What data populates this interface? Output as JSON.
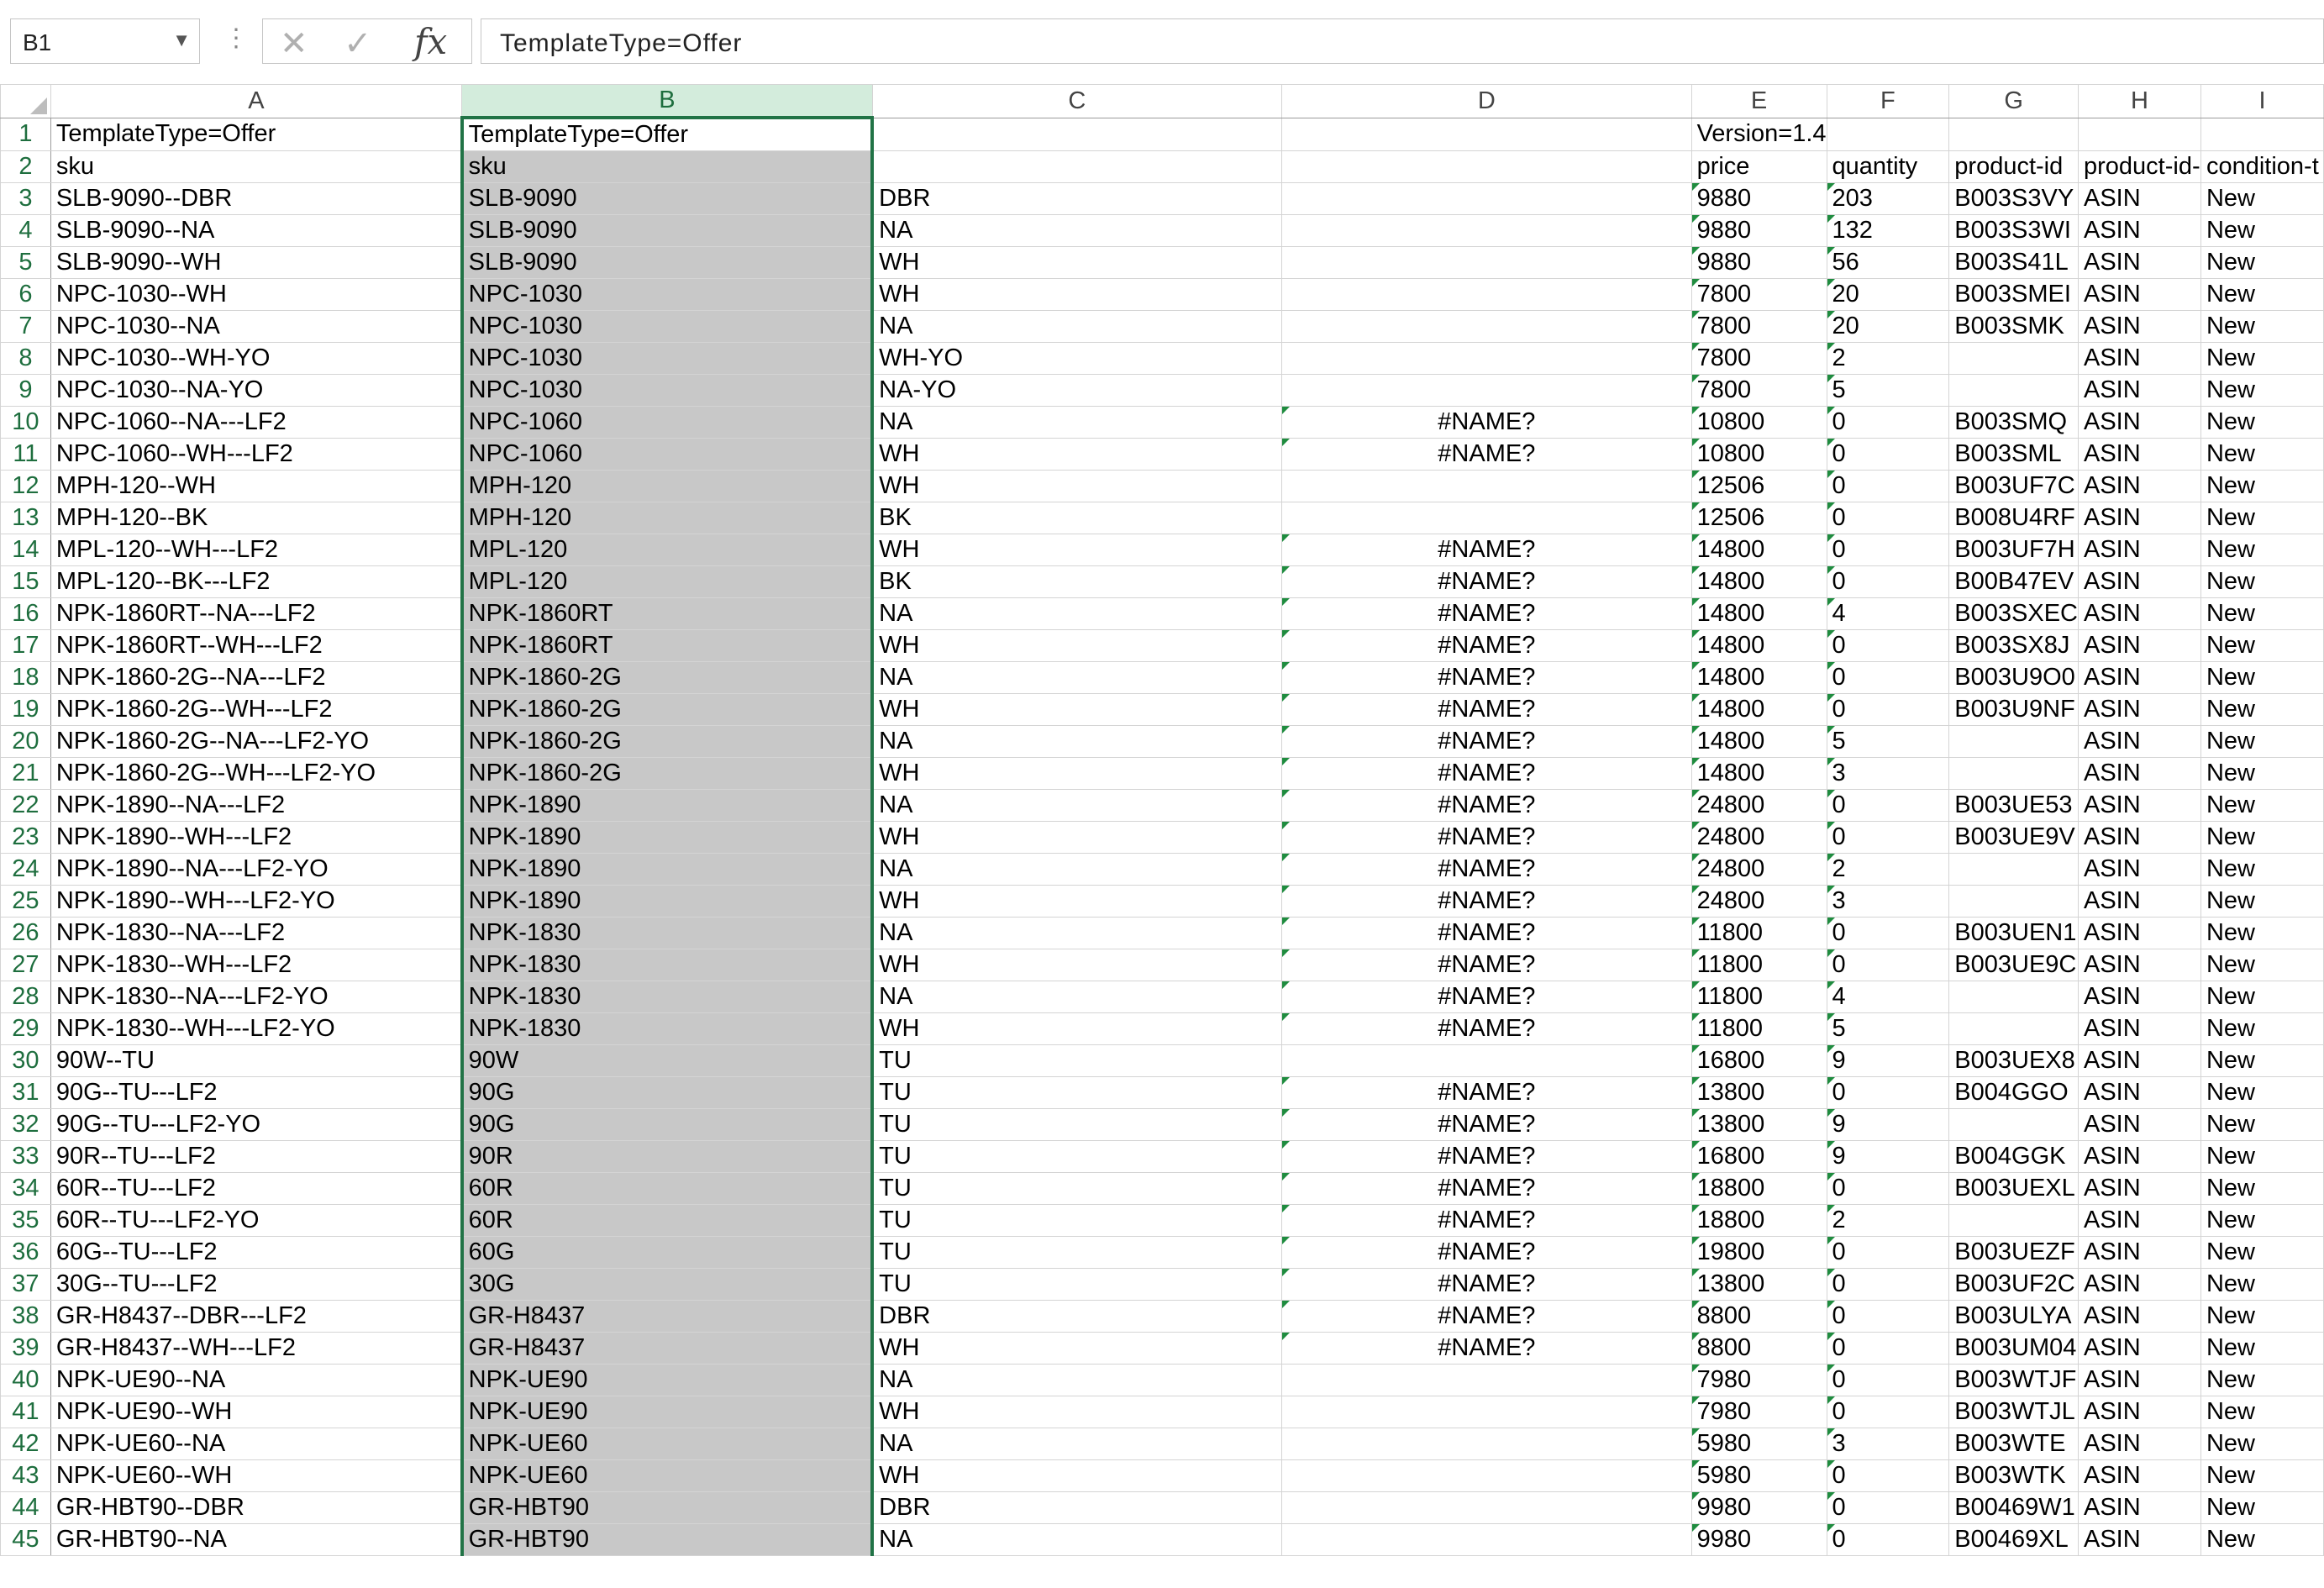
{
  "formula_bar": {
    "name_box": "B1",
    "formula": "TemplateType=Offer"
  },
  "columns": [
    "A",
    "B",
    "C",
    "D",
    "E",
    "F",
    "G",
    "H",
    "I"
  ],
  "rows": [
    {
      "n": "1",
      "a": "TemplateType=Offer",
      "b": "TemplateType=Offer",
      "c": "",
      "d": "",
      "e": "Version=1.4",
      "f": "",
      "g": "",
      "h": "",
      "i": ""
    },
    {
      "n": "2",
      "a": "sku",
      "b": "sku",
      "c": "",
      "d": "",
      "e": "price",
      "f": "quantity",
      "g": "product-id",
      "h": "product-id-",
      "i": "condition-t"
    },
    {
      "n": "3",
      "a": "SLB-9090--DBR",
      "b": "SLB-9090",
      "c": "DBR",
      "d": "",
      "e": "9880",
      "f": "203",
      "g": "B003S3VY",
      "h": "ASIN",
      "i": "New"
    },
    {
      "n": "4",
      "a": "SLB-9090--NA",
      "b": "SLB-9090",
      "c": "NA",
      "d": "",
      "e": "9880",
      "f": "132",
      "g": "B003S3WI",
      "h": "ASIN",
      "i": "New"
    },
    {
      "n": "5",
      "a": "SLB-9090--WH",
      "b": "SLB-9090",
      "c": "WH",
      "d": "",
      "e": "9880",
      "f": "56",
      "g": "B003S41L",
      "h": "ASIN",
      "i": "New"
    },
    {
      "n": "6",
      "a": "NPC-1030--WH",
      "b": "NPC-1030",
      "c": "WH",
      "d": "",
      "e": "7800",
      "f": "20",
      "g": "B003SMEI",
      "h": "ASIN",
      "i": "New"
    },
    {
      "n": "7",
      "a": "NPC-1030--NA",
      "b": "NPC-1030",
      "c": "NA",
      "d": "",
      "e": "7800",
      "f": "20",
      "g": "B003SMK",
      "h": "ASIN",
      "i": "New"
    },
    {
      "n": "8",
      "a": "NPC-1030--WH-YO",
      "b": "NPC-1030",
      "c": "WH-YO",
      "d": "",
      "e": "7800",
      "f": "2",
      "g": "",
      "h": "ASIN",
      "i": "New"
    },
    {
      "n": "9",
      "a": "NPC-1030--NA-YO",
      "b": "NPC-1030",
      "c": "NA-YO",
      "d": "",
      "e": "7800",
      "f": "5",
      "g": "",
      "h": "ASIN",
      "i": "New"
    },
    {
      "n": "10",
      "a": "NPC-1060--NA---LF2",
      "b": "NPC-1060",
      "c": "NA",
      "d": "#NAME?",
      "e": "10800",
      "f": "0",
      "g": "B003SMQ",
      "h": "ASIN",
      "i": "New"
    },
    {
      "n": "11",
      "a": "NPC-1060--WH---LF2",
      "b": "NPC-1060",
      "c": "WH",
      "d": "#NAME?",
      "e": "10800",
      "f": "0",
      "g": "B003SML",
      "h": "ASIN",
      "i": "New"
    },
    {
      "n": "12",
      "a": "MPH-120--WH",
      "b": "MPH-120",
      "c": "WH",
      "d": "",
      "e": "12506",
      "f": "0",
      "g": "B003UF7C",
      "h": "ASIN",
      "i": "New"
    },
    {
      "n": "13",
      "a": "MPH-120--BK",
      "b": "MPH-120",
      "c": "BK",
      "d": "",
      "e": "12506",
      "f": "0",
      "g": "B008U4RF",
      "h": "ASIN",
      "i": "New"
    },
    {
      "n": "14",
      "a": "MPL-120--WH---LF2",
      "b": "MPL-120",
      "c": "WH",
      "d": "#NAME?",
      "e": "14800",
      "f": "0",
      "g": "B003UF7H",
      "h": "ASIN",
      "i": "New"
    },
    {
      "n": "15",
      "a": "MPL-120--BK---LF2",
      "b": "MPL-120",
      "c": "BK",
      "d": "#NAME?",
      "e": "14800",
      "f": "0",
      "g": "B00B47EV",
      "h": "ASIN",
      "i": "New"
    },
    {
      "n": "16",
      "a": "NPK-1860RT--NA---LF2",
      "b": "NPK-1860RT",
      "c": "NA",
      "d": "#NAME?",
      "e": "14800",
      "f": "4",
      "g": "B003SXEC",
      "h": "ASIN",
      "i": "New"
    },
    {
      "n": "17",
      "a": "NPK-1860RT--WH---LF2",
      "b": "NPK-1860RT",
      "c": "WH",
      "d": "#NAME?",
      "e": "14800",
      "f": "0",
      "g": "B003SX8J",
      "h": "ASIN",
      "i": "New"
    },
    {
      "n": "18",
      "a": "NPK-1860-2G--NA---LF2",
      "b": "NPK-1860-2G",
      "c": "NA",
      "d": "#NAME?",
      "e": "14800",
      "f": "0",
      "g": "B003U9O0",
      "h": "ASIN",
      "i": "New"
    },
    {
      "n": "19",
      "a": "NPK-1860-2G--WH---LF2",
      "b": "NPK-1860-2G",
      "c": "WH",
      "d": "#NAME?",
      "e": "14800",
      "f": "0",
      "g": "B003U9NF",
      "h": "ASIN",
      "i": "New"
    },
    {
      "n": "20",
      "a": "NPK-1860-2G--NA---LF2-YO",
      "b": "NPK-1860-2G",
      "c": "NA",
      "d": "#NAME?",
      "e": "14800",
      "f": "5",
      "g": "",
      "h": "ASIN",
      "i": "New"
    },
    {
      "n": "21",
      "a": "NPK-1860-2G--WH---LF2-YO",
      "b": "NPK-1860-2G",
      "c": "WH",
      "d": "#NAME?",
      "e": "14800",
      "f": "3",
      "g": "",
      "h": "ASIN",
      "i": "New"
    },
    {
      "n": "22",
      "a": "NPK-1890--NA---LF2",
      "b": "NPK-1890",
      "c": "NA",
      "d": "#NAME?",
      "e": "24800",
      "f": "0",
      "g": "B003UE53",
      "h": "ASIN",
      "i": "New"
    },
    {
      "n": "23",
      "a": "NPK-1890--WH---LF2",
      "b": "NPK-1890",
      "c": "WH",
      "d": "#NAME?",
      "e": "24800",
      "f": "0",
      "g": "B003UE9V",
      "h": "ASIN",
      "i": "New"
    },
    {
      "n": "24",
      "a": "NPK-1890--NA---LF2-YO",
      "b": "NPK-1890",
      "c": "NA",
      "d": "#NAME?",
      "e": "24800",
      "f": "2",
      "g": "",
      "h": "ASIN",
      "i": "New"
    },
    {
      "n": "25",
      "a": "NPK-1890--WH---LF2-YO",
      "b": "NPK-1890",
      "c": "WH",
      "d": "#NAME?",
      "e": "24800",
      "f": "3",
      "g": "",
      "h": "ASIN",
      "i": "New"
    },
    {
      "n": "26",
      "a": "NPK-1830--NA---LF2",
      "b": "NPK-1830",
      "c": "NA",
      "d": "#NAME?",
      "e": "11800",
      "f": "0",
      "g": "B003UEN1",
      "h": "ASIN",
      "i": "New"
    },
    {
      "n": "27",
      "a": "NPK-1830--WH---LF2",
      "b": "NPK-1830",
      "c": "WH",
      "d": "#NAME?",
      "e": "11800",
      "f": "0",
      "g": "B003UE9C",
      "h": "ASIN",
      "i": "New"
    },
    {
      "n": "28",
      "a": "NPK-1830--NA---LF2-YO",
      "b": "NPK-1830",
      "c": "NA",
      "d": "#NAME?",
      "e": "11800",
      "f": "4",
      "g": "",
      "h": "ASIN",
      "i": "New"
    },
    {
      "n": "29",
      "a": "NPK-1830--WH---LF2-YO",
      "b": "NPK-1830",
      "c": "WH",
      "d": "#NAME?",
      "e": "11800",
      "f": "5",
      "g": "",
      "h": "ASIN",
      "i": "New"
    },
    {
      "n": "30",
      "a": "90W--TU",
      "b": "90W",
      "c": "TU",
      "d": "",
      "e": "16800",
      "f": "9",
      "g": "B003UEX8",
      "h": "ASIN",
      "i": "New"
    },
    {
      "n": "31",
      "a": "90G--TU---LF2",
      "b": "90G",
      "c": "TU",
      "d": "#NAME?",
      "e": "13800",
      "f": "0",
      "g": "B004GGO",
      "h": "ASIN",
      "i": "New"
    },
    {
      "n": "32",
      "a": "90G--TU---LF2-YO",
      "b": "90G",
      "c": "TU",
      "d": "#NAME?",
      "e": "13800",
      "f": "9",
      "g": "",
      "h": "ASIN",
      "i": "New"
    },
    {
      "n": "33",
      "a": "90R--TU---LF2",
      "b": "90R",
      "c": "TU",
      "d": "#NAME?",
      "e": "16800",
      "f": "9",
      "g": "B004GGK",
      "h": "ASIN",
      "i": "New"
    },
    {
      "n": "34",
      "a": "60R--TU---LF2",
      "b": "60R",
      "c": "TU",
      "d": "#NAME?",
      "e": "18800",
      "f": "0",
      "g": "B003UEXL",
      "h": "ASIN",
      "i": "New"
    },
    {
      "n": "35",
      "a": "60R--TU---LF2-YO",
      "b": "60R",
      "c": "TU",
      "d": "#NAME?",
      "e": "18800",
      "f": "2",
      "g": "",
      "h": "ASIN",
      "i": "New"
    },
    {
      "n": "36",
      "a": "60G--TU---LF2",
      "b": "60G",
      "c": "TU",
      "d": "#NAME?",
      "e": "19800",
      "f": "0",
      "g": "B003UEZF",
      "h": "ASIN",
      "i": "New"
    },
    {
      "n": "37",
      "a": "30G--TU---LF2",
      "b": "30G",
      "c": "TU",
      "d": "#NAME?",
      "e": "13800",
      "f": "0",
      "g": "B003UF2C",
      "h": "ASIN",
      "i": "New"
    },
    {
      "n": "38",
      "a": "GR-H8437--DBR---LF2",
      "b": "GR-H8437",
      "c": "DBR",
      "d": "#NAME?",
      "e": "8800",
      "f": "0",
      "g": "B003ULYA",
      "h": "ASIN",
      "i": "New"
    },
    {
      "n": "39",
      "a": "GR-H8437--WH---LF2",
      "b": "GR-H8437",
      "c": "WH",
      "d": "#NAME?",
      "e": "8800",
      "f": "0",
      "g": "B003UM04",
      "h": "ASIN",
      "i": "New"
    },
    {
      "n": "40",
      "a": "NPK-UE90--NA",
      "b": "NPK-UE90",
      "c": "NA",
      "d": "",
      "e": "7980",
      "f": "0",
      "g": "B003WTJF",
      "h": "ASIN",
      "i": "New"
    },
    {
      "n": "41",
      "a": "NPK-UE90--WH",
      "b": "NPK-UE90",
      "c": "WH",
      "d": "",
      "e": "7980",
      "f": "0",
      "g": "B003WTJL",
      "h": "ASIN",
      "i": "New"
    },
    {
      "n": "42",
      "a": "NPK-UE60--NA",
      "b": "NPK-UE60",
      "c": "NA",
      "d": "",
      "e": "5980",
      "f": "3",
      "g": "B003WTE",
      "h": "ASIN",
      "i": "New"
    },
    {
      "n": "43",
      "a": "NPK-UE60--WH",
      "b": "NPK-UE60",
      "c": "WH",
      "d": "",
      "e": "5980",
      "f": "0",
      "g": "B003WTK",
      "h": "ASIN",
      "i": "New"
    },
    {
      "n": "44",
      "a": "GR-HBT90--DBR",
      "b": "GR-HBT90",
      "c": "DBR",
      "d": "",
      "e": "9980",
      "f": "0",
      "g": "B00469W1",
      "h": "ASIN",
      "i": "New"
    },
    {
      "n": "45",
      "a": "GR-HBT90--NA",
      "b": "GR-HBT90",
      "c": "NA",
      "d": "",
      "e": "9980",
      "f": "0",
      "g": "B00469XL",
      "h": "ASIN",
      "i": "New"
    }
  ]
}
